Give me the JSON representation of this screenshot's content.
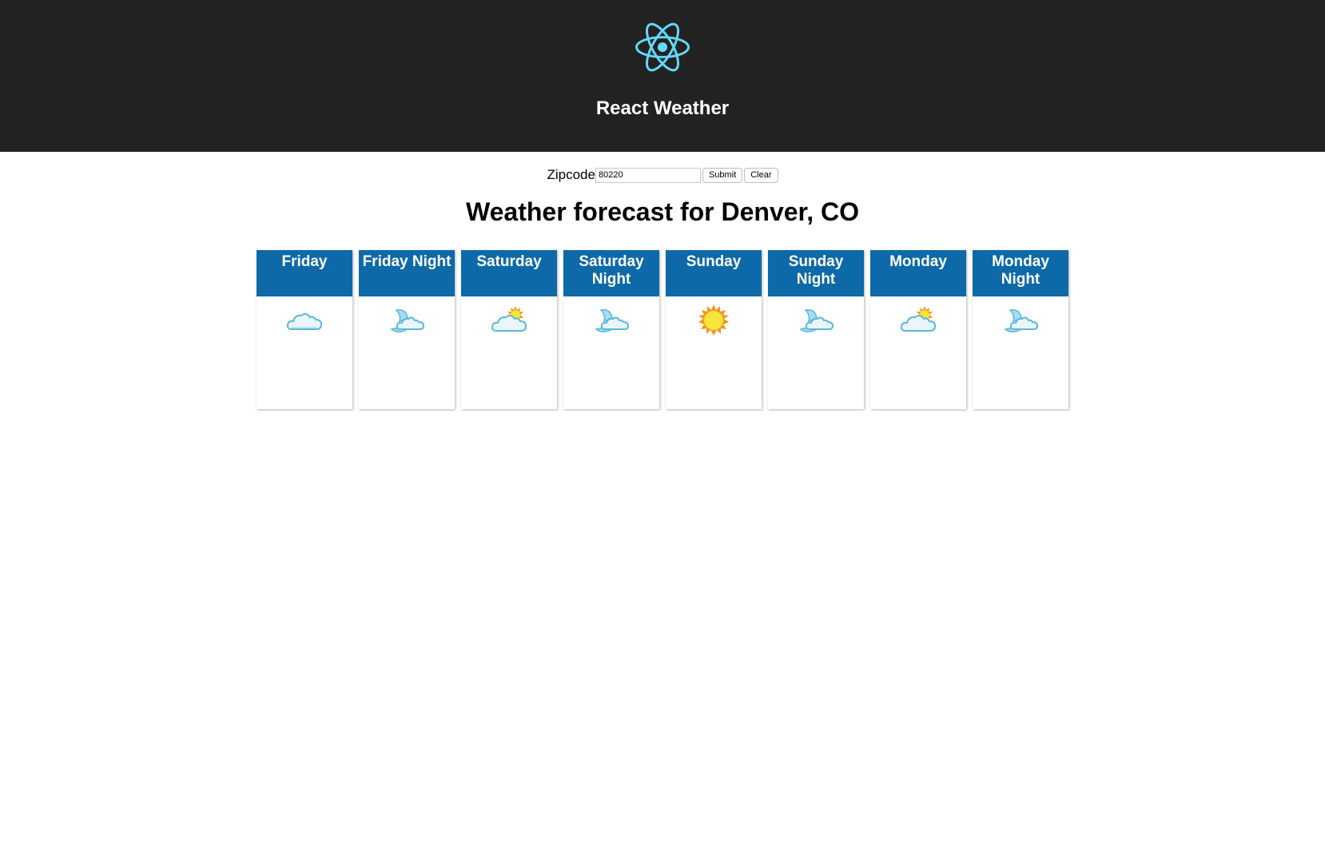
{
  "header": {
    "logo_icon": "react-atom-icon",
    "title": "React Weather",
    "accent_color": "#61dafb",
    "background_color": "#222222"
  },
  "form": {
    "zip_label": "Zipcode",
    "zip_value": "80220",
    "submit_label": "Submit",
    "clear_label": "Clear"
  },
  "forecast": {
    "title": "Weather forecast for Denver, CO",
    "header_color": "#0e69a8",
    "periods": [
      {
        "name": "Friday",
        "icon": "cloudy-icon"
      },
      {
        "name": "Friday Night",
        "icon": "partly-cloudy-night-icon"
      },
      {
        "name": "Saturday",
        "icon": "partly-sunny-icon"
      },
      {
        "name": "Saturday Night",
        "icon": "partly-cloudy-night-icon"
      },
      {
        "name": "Sunday",
        "icon": "sunny-icon"
      },
      {
        "name": "Sunday Night",
        "icon": "partly-cloudy-night-icon"
      },
      {
        "name": "Monday",
        "icon": "partly-sunny-icon"
      },
      {
        "name": "Monday Night",
        "icon": "partly-cloudy-night-icon"
      }
    ]
  }
}
